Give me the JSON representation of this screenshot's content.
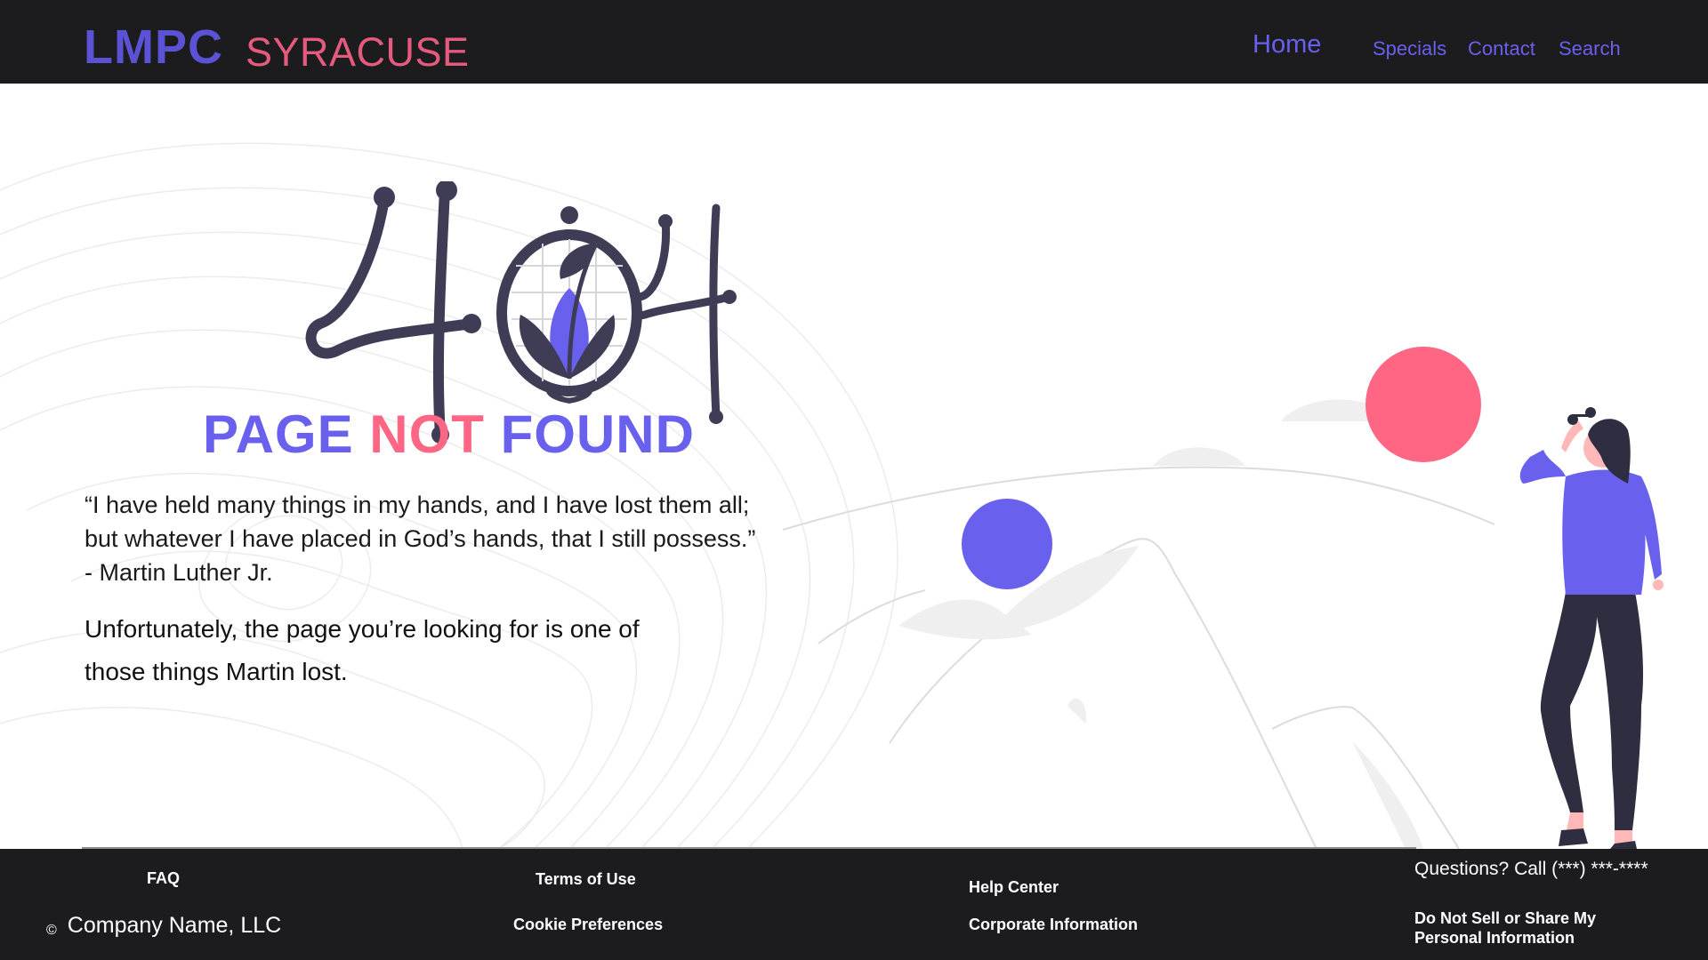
{
  "header": {
    "brand": "LMPC",
    "city": "SYRACUSE",
    "nav": {
      "home": "Home",
      "specials": "Specials",
      "contact": "Contact",
      "search": "Search"
    }
  },
  "main": {
    "error_code": "404",
    "headline": {
      "word1": "PAGE",
      "word2": "NOT",
      "word3": "FOUND"
    },
    "quote_lines": [
      "“I have held many things in my hands, and I have lost them all;",
      "but whatever I have placed in God’s hands, that I still possess.”",
      "- Martin Luther Jr."
    ],
    "message_lines": [
      "Unfortunately, the page you’re looking for is one of",
      "those things Martin lost."
    ]
  },
  "footer": {
    "faq": "FAQ",
    "terms": "Terms of Use",
    "help": "Help Center",
    "questions": "Questions? Call (***) ***-****",
    "copyright_symbol": "©",
    "company": "Company Name, LLC",
    "cookie": "Cookie Preferences",
    "corporate": "Corporate Information",
    "do_not_sell": "Do Not Sell or Share My Personal Information"
  },
  "colors": {
    "header_bg": "#1c1b1d",
    "brand_purple": "#5b52d6",
    "accent_purple": "#6a60ee",
    "accent_pink": "#ff6684",
    "ink": "#3f3d56"
  },
  "icons": [
    "copyright-icon",
    "plant-in-globe-icon"
  ]
}
